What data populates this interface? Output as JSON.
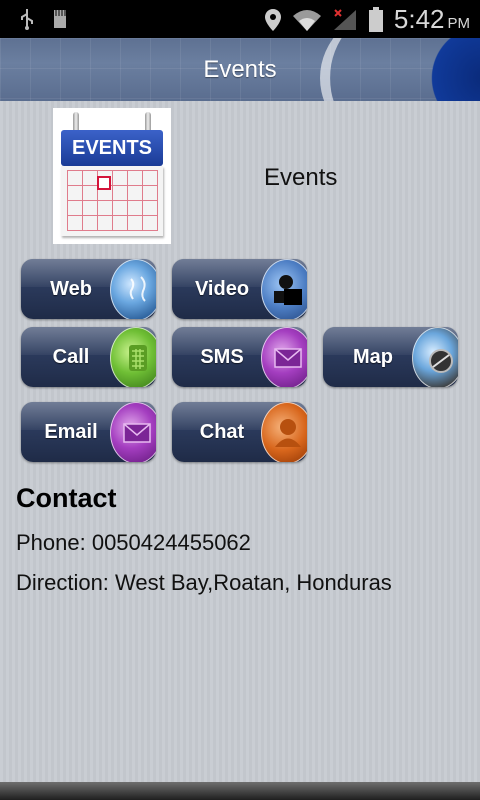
{
  "status_bar": {
    "time": "5:42",
    "ampm": "PM",
    "icons": [
      "usb-icon",
      "sd-card-icon",
      "location-icon",
      "wifi-icon",
      "signal-icon",
      "battery-icon"
    ]
  },
  "titlebar": {
    "title": "Events"
  },
  "header": {
    "logo_text": "EVENTS",
    "label": "Events"
  },
  "buttons": [
    {
      "label": "Web",
      "icon": "globe-icon"
    },
    {
      "label": "Video",
      "icon": "video-icon"
    },
    {
      "label": "Call",
      "icon": "phone-icon"
    },
    {
      "label": "SMS",
      "icon": "envelope-icon"
    },
    {
      "label": "Map",
      "icon": "compass-icon"
    },
    {
      "label": "Email",
      "icon": "envelope-icon"
    },
    {
      "label": "Chat",
      "icon": "chat-person-icon"
    }
  ],
  "contact": {
    "title": "Contact",
    "phone": "Phone: 0050424455062",
    "direction": "Direction: West Bay,Roatan, Honduras"
  }
}
